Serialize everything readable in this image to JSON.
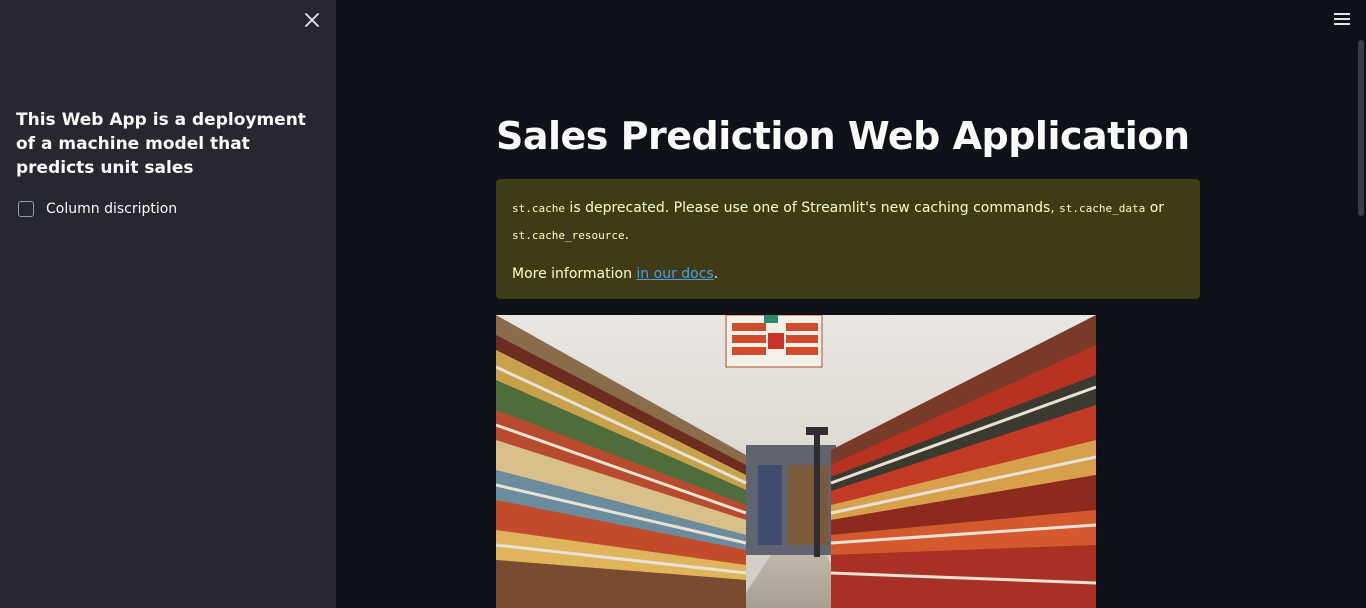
{
  "sidebar": {
    "heading": "This Web App is a deployment of a machine model that predicts unit sales",
    "checkbox_label": "Column discription",
    "checkbox_checked": false,
    "close_icon": "close-icon"
  },
  "header": {
    "menu_icon": "hamburger-menu-icon"
  },
  "main": {
    "title": "Sales Prediction Web Application",
    "warning": {
      "code_cache": "st.cache",
      "text1": " is deprecated. Please use one of Streamlit's new caching commands, ",
      "code_cache_data": "st.cache_data",
      "text_or": " or",
      "code_cache_resource": "st.cache_resource",
      "period": ".",
      "more_info": "More information ",
      "link_text": "in our docs",
      "end": "."
    },
    "image_alt": "grocery store aisle"
  },
  "colors": {
    "background": "#0e1117",
    "sidebar": "#262730",
    "warning_bg": "#3e3b16",
    "warning_text": "#ffffc2",
    "link": "#4f9de8"
  }
}
